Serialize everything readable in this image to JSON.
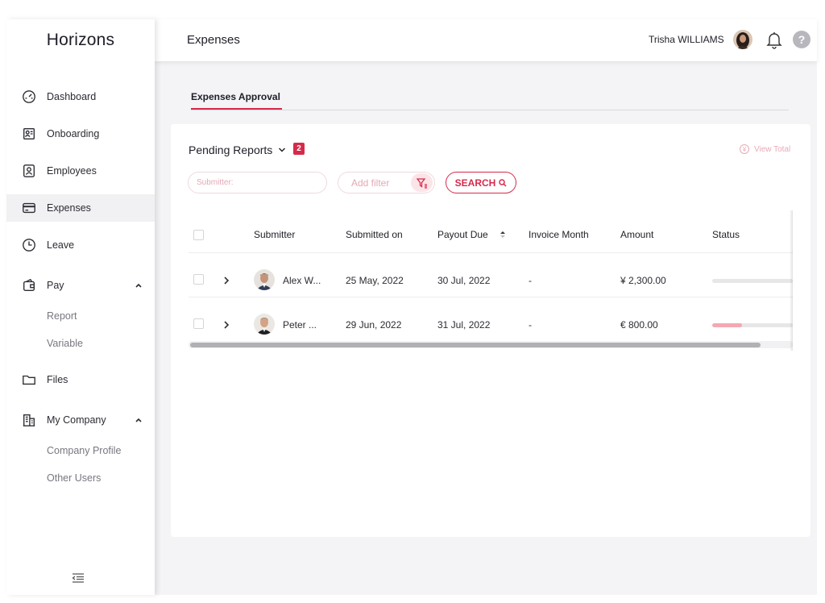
{
  "app": {
    "logo": "Horizons"
  },
  "sidebar": {
    "items": [
      {
        "label": "Dashboard",
        "icon": "gauge-icon"
      },
      {
        "label": "Onboarding",
        "icon": "onboarding-icon"
      },
      {
        "label": "Employees",
        "icon": "employee-badge-icon"
      },
      {
        "label": "Expenses",
        "icon": "card-icon",
        "active": true
      },
      {
        "label": "Leave",
        "icon": "clock-icon"
      },
      {
        "label": "Pay",
        "icon": "wallet-icon",
        "expanded": true,
        "children": [
          "Report",
          "Variable"
        ]
      },
      {
        "label": "Files",
        "icon": "folder-icon"
      },
      {
        "label": "My Company",
        "icon": "building-icon",
        "expanded": true,
        "children": [
          "Company Profile",
          "Other Users"
        ]
      }
    ]
  },
  "header": {
    "title": "Expenses",
    "user_name": "Trisha WILLIAMS"
  },
  "tabs": [
    {
      "label": "Expenses Approval",
      "active": true
    }
  ],
  "card": {
    "pending_label": "Pending Reports",
    "pending_count": "2",
    "view_total": "View Total",
    "submitter_placeholder": "Submitter:",
    "add_filter": "Add filter",
    "search_label": "SEARCH"
  },
  "table": {
    "columns": [
      "Submitter",
      "Submitted on",
      "Payout Due",
      "Invoice Month",
      "Amount",
      "Status"
    ],
    "rows": [
      {
        "submitter": "Alex W...",
        "submitted_on": "25 May, 2022",
        "payout_due": "30 Jul, 2022",
        "invoice_month": "-",
        "amount": "¥ 2,300.00",
        "status_progress": 0
      },
      {
        "submitter": "Peter ...",
        "submitted_on": "29 Jun, 2022",
        "payout_due": "31 Jul, 2022",
        "invoice_month": "-",
        "amount": "€ 800.00",
        "status_progress": 0.37
      }
    ]
  },
  "colors": {
    "accent": "#d62a4a",
    "accent_light": "#fbe4e8",
    "status_fill": "#f4a8b2",
    "sidebar_active": "#f1f1f3"
  }
}
